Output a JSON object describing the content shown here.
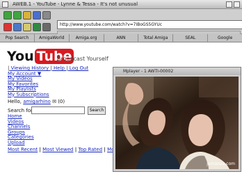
{
  "window": {
    "title": "AWEB.1 - YouTube - Lynne & Tessa - It's not unusual"
  },
  "toolbar": {
    "url": "http://www.youtube.com/watch?v=7IBoGS5GYUc"
  },
  "bookmarks": [
    "Pop Search",
    "AmigaWorld",
    "Amiga.org",
    "ANN",
    "Total Amiga",
    "SEAL",
    "Google"
  ],
  "page": {
    "logo_you": "You",
    "logo_tube": "Tube",
    "tagline": "Broadcast Yourself",
    "links": {
      "viewing_history": "Viewing History",
      "help": "Help",
      "logout": "Log Out",
      "my_account": "My Account",
      "my_videos": "My Videos",
      "my_favorites": "My Favorites",
      "my_playlists": "My Playlists",
      "my_subscriptions": "My Subscriptions"
    },
    "hello_prefix": "Hello,",
    "username": "amigarhino",
    "mail_count": "(0)",
    "search_label": "Search for",
    "search_button": "Search",
    "nav": [
      "Home",
      "Videos",
      "Channels",
      "Groups",
      "Categories",
      "Upload"
    ],
    "tabs": [
      "Most Recent",
      "Most Viewed",
      "Top Rated",
      "Most Disc"
    ]
  },
  "player": {
    "title": "Mplayer - 1 AWTI-00002",
    "watermark": "jamanaa.com"
  }
}
